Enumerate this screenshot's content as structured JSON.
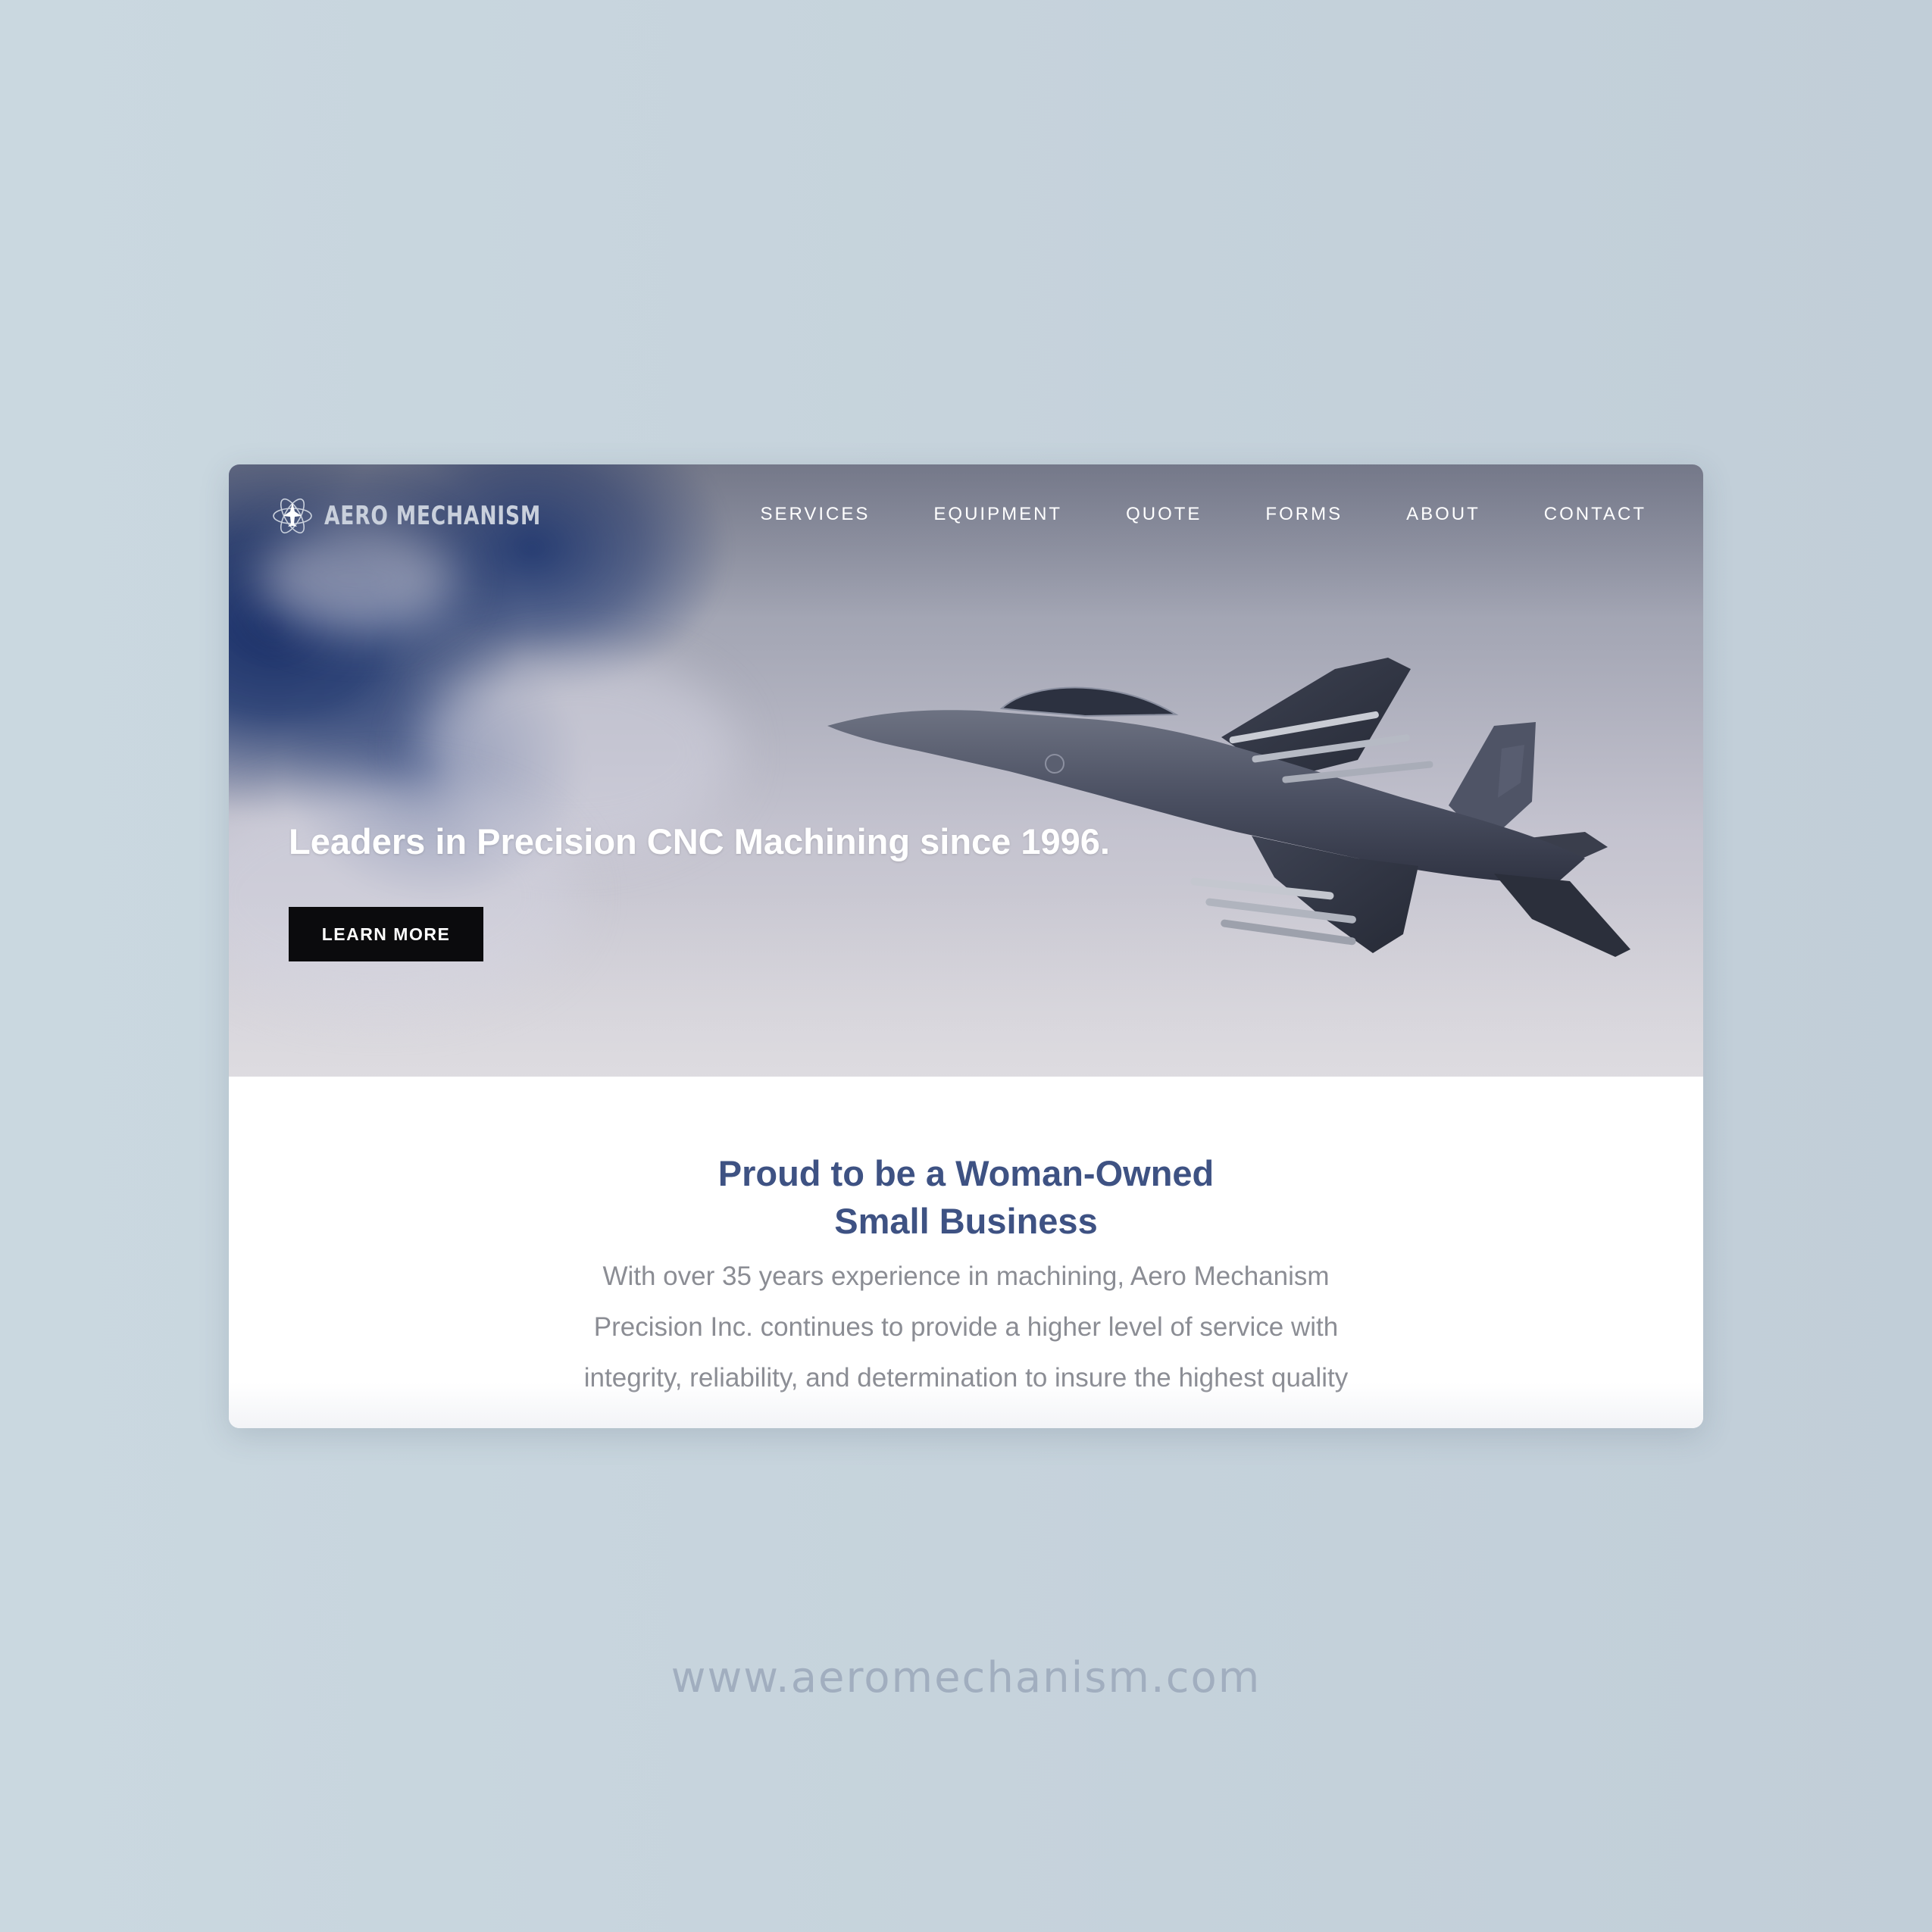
{
  "brand": {
    "name": "AERO MECHANISM",
    "logo_icon": "atom-jet-icon"
  },
  "nav": {
    "items": [
      {
        "label": "SERVICES"
      },
      {
        "label": "EQUIPMENT"
      },
      {
        "label": "QUOTE"
      },
      {
        "label": "FORMS"
      },
      {
        "label": "ABOUT"
      },
      {
        "label": "CONTACT"
      }
    ]
  },
  "hero": {
    "title": "Leaders in Precision CNC Machining since 1996.",
    "button_label": "LEARN MORE",
    "image": "fighter-jet-photo"
  },
  "intro": {
    "heading_lines": [
      "Proud to be a Woman-Owned",
      "Small Business"
    ],
    "body_lines": [
      "With over 35 years experience in machining, Aero Mechanism",
      "Precision Inc. continues to provide a higher level of service with",
      "integrity, reliability, and determination to insure the highest quality"
    ]
  },
  "footer": {
    "url": "www.aeromechanism.com"
  },
  "colors": {
    "background": "#c6d3dc",
    "heading": "#3e5283",
    "body_text": "#8b8d94",
    "button_bg": "#0b0b0d",
    "url_text": "#a1aebf"
  }
}
